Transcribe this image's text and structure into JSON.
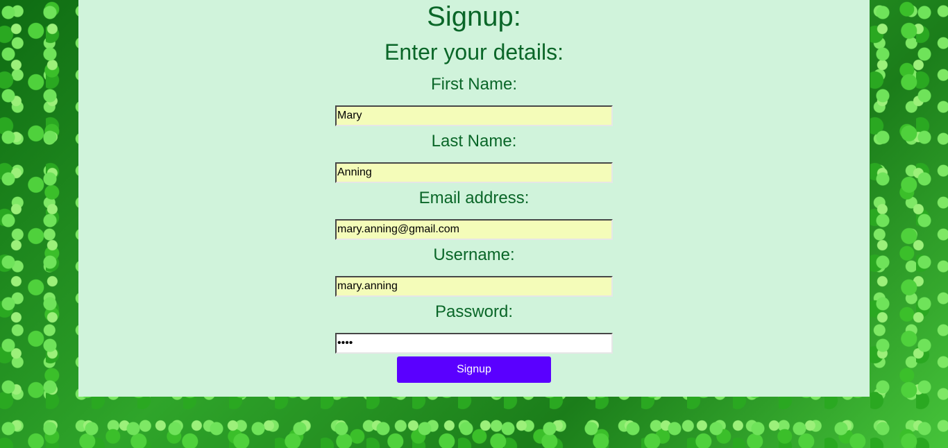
{
  "page": {
    "title": "Signup:",
    "subtitle": "Enter your details:"
  },
  "form": {
    "first_name": {
      "label": "First Name:",
      "value": "Mary"
    },
    "last_name": {
      "label": "Last Name:",
      "value": "Anning"
    },
    "email": {
      "label": "Email address:",
      "value": "mary.anning@gmail.com"
    },
    "username": {
      "label": "Username:",
      "value": "mary.anning"
    },
    "password": {
      "label": "Password:",
      "value": "abcd"
    },
    "submit_label": "Signup"
  },
  "colors": {
    "panel_bg": "#d0f3db",
    "heading_text": "#0a6628",
    "autofill_bg": "#f4fcb9",
    "button_bg": "#5a00ff",
    "button_text": "#ffffff"
  },
  "background": {
    "description_icon": "clover-leaves-background"
  }
}
